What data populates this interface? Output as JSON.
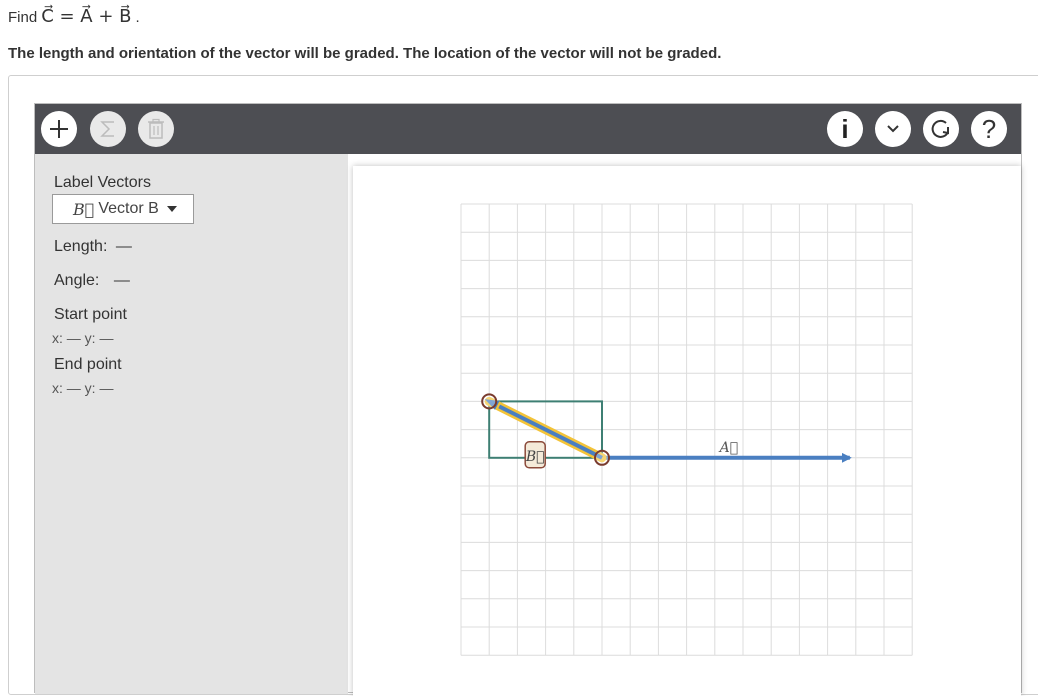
{
  "prompt": {
    "find_label": "Find",
    "equation": "C⃗ = A⃗ + B⃗",
    "period": "."
  },
  "instruction": "The length and orientation of the vector will be graded. The location of the vector will not be graded.",
  "toolbar": {
    "left_buttons": [
      {
        "icon": "plus-icon",
        "state": "enabled"
      },
      {
        "icon": "sigma-icon",
        "state": "disabled"
      },
      {
        "icon": "trash-icon",
        "state": "disabled"
      }
    ],
    "right_buttons": [
      {
        "icon": "info-icon",
        "label": "i"
      },
      {
        "icon": "chevron-down-icon"
      },
      {
        "icon": "reset-icon"
      },
      {
        "icon": "help-icon",
        "label": "?"
      }
    ]
  },
  "sidebar": {
    "label_vectors": "Label Vectors",
    "dropdown": {
      "symbol": "B⃗",
      "text": "Vector B"
    },
    "length_label": "Length:",
    "length_value": "—",
    "angle_label": "Angle:",
    "angle_value": "—",
    "start_point_label": "Start point",
    "start_point_coords": "x: — y: —",
    "end_point_label": "End point",
    "end_point_coords": "x: — y: —"
  },
  "canvas": {
    "grid": {
      "columns": 16,
      "rows": 16
    },
    "vectors": [
      {
        "label": "A⃗",
        "color": "#4a7fc1",
        "start": [
          5,
          9
        ],
        "end": [
          14,
          9
        ]
      },
      {
        "label": "B⃗",
        "color": "#4a7fc1",
        "start": [
          5,
          9
        ],
        "end": [
          1,
          7
        ],
        "selected": true,
        "selection_color": "#f3c338"
      }
    ],
    "selection_box_color": "#3e7f73",
    "handle_color": "#7a3b2e"
  }
}
